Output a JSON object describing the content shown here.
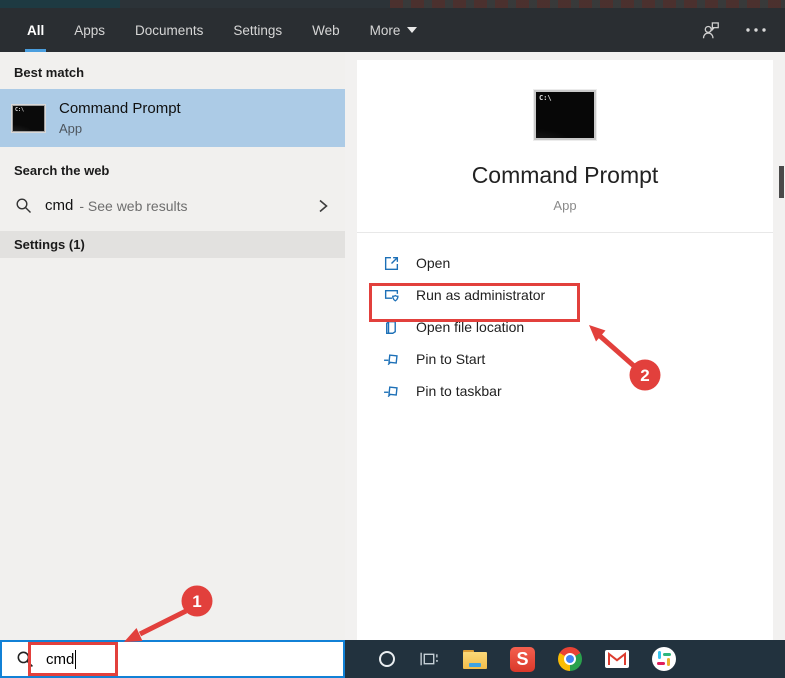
{
  "navbar": {
    "tabs": [
      {
        "label": "All",
        "active": true
      },
      {
        "label": "Apps"
      },
      {
        "label": "Documents"
      },
      {
        "label": "Settings"
      },
      {
        "label": "Web"
      },
      {
        "label": "More",
        "has_caret": true
      }
    ],
    "icon_names": [
      "feedback-icon",
      "ellipsis-icon"
    ],
    "active_underline_color": "#4a9ede"
  },
  "left_panel": {
    "best_match_header": "Best match",
    "best_match_item": {
      "title": "Command Prompt",
      "type": "App",
      "icon": "command-prompt-icon"
    },
    "search_web_header": "Search the web",
    "web_search_item": {
      "query": "cmd",
      "hint": "- See web results",
      "icon": "search-icon",
      "chevron": "chevron-right-icon"
    },
    "settings_header": "Settings (1)",
    "selection_highlight_color": "#accbe6"
  },
  "preview_panel": {
    "app_title": "Command Prompt",
    "app_type": "App",
    "app_icon": "command-prompt-icon",
    "cmd_icon_text": "C:\\",
    "actions": [
      {
        "label": "Open",
        "icon": "open-icon"
      },
      {
        "label": "Run as administrator",
        "icon": "run-as-administrator-icon"
      },
      {
        "label": "Open file location",
        "icon": "open-file-location-icon"
      },
      {
        "label": "Pin to Start",
        "icon": "pin-icon"
      },
      {
        "label": "Pin to taskbar",
        "icon": "pin-icon"
      }
    ],
    "action_icon_color": "#1d70b7"
  },
  "search_box": {
    "value": "cmd",
    "icon": "search-icon",
    "border_color": "#1181d6"
  },
  "annotations": {
    "step1": "1",
    "step2": "2",
    "accent_color": "#e2403c",
    "highlighted_action": "Run as administrator",
    "highlighted_input_text": "cmd"
  },
  "taskbar": {
    "icons": [
      "cortana-icon",
      "task-view-icon",
      "file-explorer-icon",
      "s-app-icon",
      "chrome-icon",
      "gmail-icon",
      "slack-icon"
    ],
    "s_app_letter": "S",
    "background_color": "#22323e"
  }
}
